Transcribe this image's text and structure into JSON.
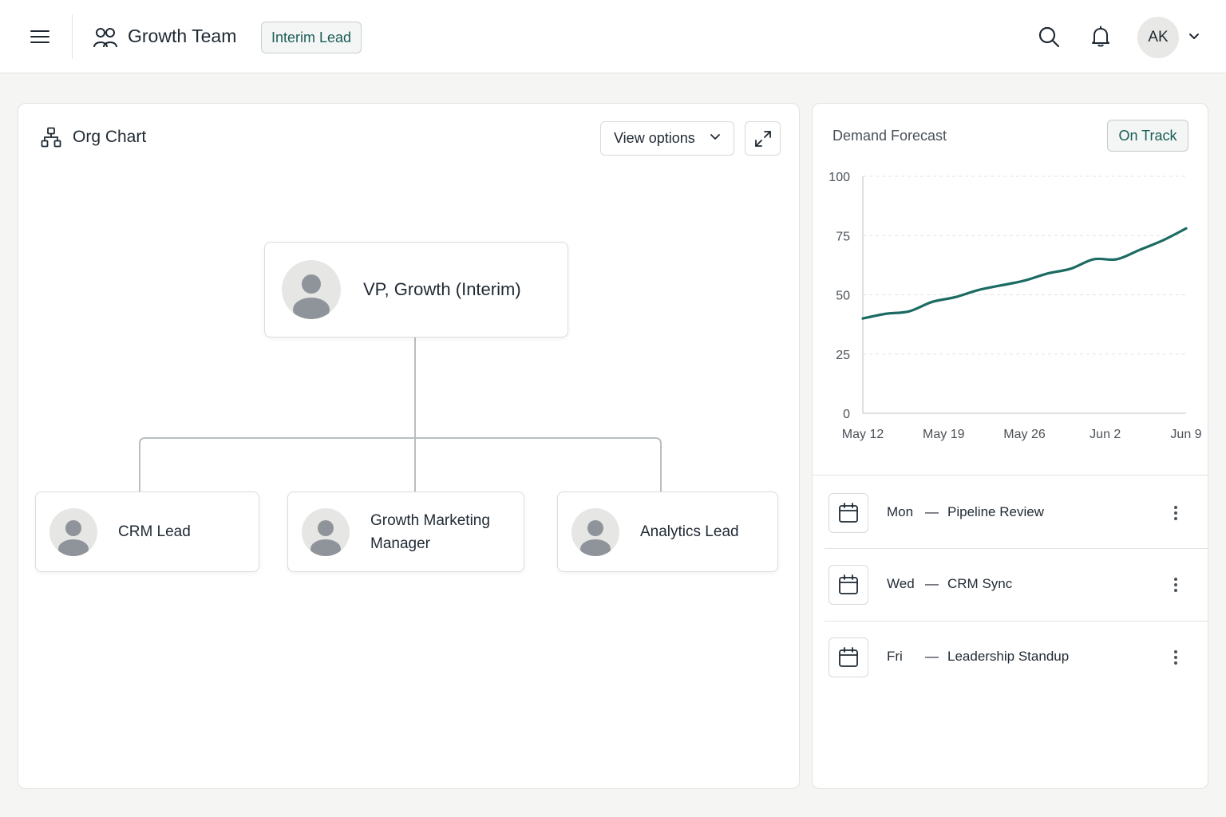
{
  "header": {
    "team_title": "Growth Team",
    "role_badge": "Interim Lead",
    "user_initials": "AK",
    "icons": [
      "hamburger-menu-icon",
      "team-icon",
      "search-icon",
      "bell-icon",
      "chevron-down-icon"
    ]
  },
  "org_chart": {
    "title": "Org Chart",
    "view_options_label": "View options",
    "root": {
      "title": "VP, Growth (Interim)"
    },
    "children": [
      {
        "title": "CRM Lead"
      },
      {
        "title": "Growth Marketing Manager"
      },
      {
        "title": "Analytics Lead"
      }
    ]
  },
  "forecast": {
    "title": "Demand Forecast",
    "status": "On Track",
    "accent_color": "#1b6b63"
  },
  "chart_data": {
    "type": "line",
    "title": "",
    "xlabel": "",
    "ylabel": "",
    "x_ticks": [
      "May 12",
      "May 19",
      "May 26",
      "Jun 2",
      "Jun 9"
    ],
    "y_ticks": [
      "0",
      "25",
      "50",
      "75",
      "100"
    ],
    "ylim": [
      0,
      100
    ],
    "grid": true,
    "series": [
      {
        "values": [
          {
            "x": "2024-05-12",
            "y": 40
          },
          {
            "x": "2024-05-14",
            "y": 42
          },
          {
            "x": "2024-05-16",
            "y": 43
          },
          {
            "x": "2024-05-18",
            "y": 47
          },
          {
            "x": "2024-05-20",
            "y": 49
          },
          {
            "x": "2024-05-22",
            "y": 52
          },
          {
            "x": "2024-05-24",
            "y": 54
          },
          {
            "x": "2024-05-26",
            "y": 56
          },
          {
            "x": "2024-05-28",
            "y": 59
          },
          {
            "x": "2024-05-30",
            "y": 61
          },
          {
            "x": "2024-06-01",
            "y": 65
          },
          {
            "x": "2024-06-03",
            "y": 65
          },
          {
            "x": "2024-06-05",
            "y": 69
          },
          {
            "x": "2024-06-07",
            "y": 73
          },
          {
            "x": "2024-06-09",
            "y": 78
          }
        ]
      }
    ]
  },
  "schedule": [
    {
      "day": "Mon",
      "separator": "—",
      "title": "Pipeline Review"
    },
    {
      "day": "Wed",
      "separator": "—",
      "title": "CRM Sync"
    },
    {
      "day": "Fri",
      "separator": "—",
      "title": "Leadership Standup"
    }
  ]
}
